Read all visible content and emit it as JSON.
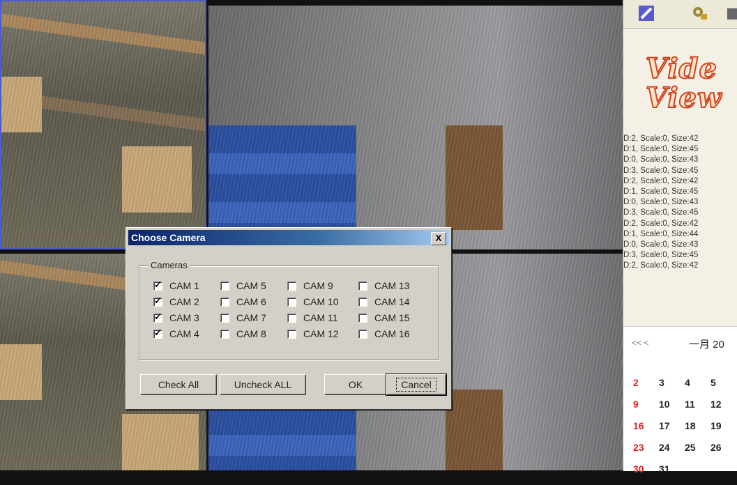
{
  "dialog": {
    "title": "Choose Camera",
    "close_label": "X",
    "group_label": "Cameras",
    "cameras": [
      {
        "label": "CAM 1",
        "checked": true
      },
      {
        "label": "CAM 2",
        "checked": true
      },
      {
        "label": "CAM 3",
        "checked": true
      },
      {
        "label": "CAM 4",
        "checked": true
      },
      {
        "label": "CAM 5",
        "checked": false
      },
      {
        "label": "CAM 6",
        "checked": false
      },
      {
        "label": "CAM 7",
        "checked": false
      },
      {
        "label": "CAM 8",
        "checked": false
      },
      {
        "label": "CAM 9",
        "checked": false
      },
      {
        "label": "CAM 10",
        "checked": false
      },
      {
        "label": "CAM 11",
        "checked": false
      },
      {
        "label": "CAM 12",
        "checked": false
      },
      {
        "label": "CAM 13",
        "checked": false
      },
      {
        "label": "CAM 14",
        "checked": false
      },
      {
        "label": "CAM 15",
        "checked": false
      },
      {
        "label": "CAM 16",
        "checked": false
      }
    ],
    "buttons": {
      "check_all": "Check All",
      "uncheck_all": "Uncheck ALL",
      "ok": "OK",
      "cancel": "Cancel"
    }
  },
  "right_panel": {
    "toolbar_icons": [
      "edit-icon",
      "camera-settings-icon"
    ],
    "brand_text": "Vide\nView",
    "log_lines": [
      "D:2, Scale:0, Size:42",
      "D:1, Scale:0, Size:45",
      "D:0, Scale:0, Size:43",
      "D:3, Scale:0, Size:45",
      "D:2, Scale:0, Size:42",
      "D:1, Scale:0, Size:45",
      "D:0, Scale:0, Size:43",
      "D:3, Scale:0, Size:45",
      "D:2, Scale:0, Size:42",
      "D:1, Scale:0, Size:44",
      "D:0, Scale:0, Size:43",
      "D:3, Scale:0, Size:45",
      "D:2, Scale:0, Size:42"
    ],
    "calendar": {
      "nav": "<< <",
      "month": "一月 20",
      "weeks": [
        [
          "2",
          "3",
          "4",
          "5"
        ],
        [
          "9",
          "10",
          "11",
          "12"
        ],
        [
          "16",
          "17",
          "18",
          "19"
        ],
        [
          "23",
          "24",
          "25",
          "26"
        ],
        [
          "30",
          "31"
        ]
      ]
    }
  }
}
